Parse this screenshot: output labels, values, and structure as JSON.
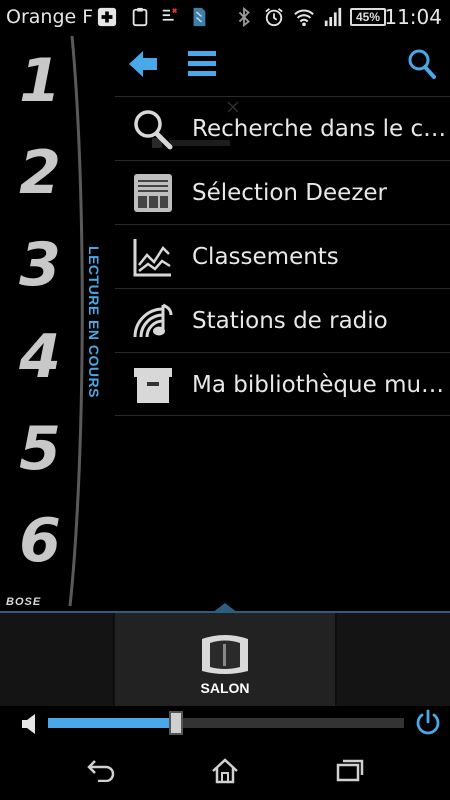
{
  "status_bar": {
    "carrier": "Orange F",
    "battery": "45%",
    "time": "11:04",
    "icons": [
      "health-icon",
      "clipboard-icon",
      "mail-icon",
      "sd-card-icon",
      "bluetooth-icon",
      "alarm-icon",
      "wifi-icon",
      "signal-icon",
      "battery-icon"
    ]
  },
  "presets": {
    "numbers": [
      "1",
      "2",
      "3",
      "4",
      "5",
      "6"
    ],
    "now_playing_label": "LECTURE EN COURS",
    "brand": "BOSE"
  },
  "toolbar": {
    "icons": [
      "back-arrow-icon",
      "menu-list-icon",
      "search-icon"
    ]
  },
  "menu": {
    "items": [
      {
        "label": "Recherche dans le c…",
        "icon": "search-icon"
      },
      {
        "label": "Sélection Deezer",
        "icon": "deezer-icon"
      },
      {
        "label": "Classements",
        "icon": "chart-icon"
      },
      {
        "label": "Stations de radio",
        "icon": "radio-icon"
      },
      {
        "label": "Ma bibliothèque mu…",
        "icon": "archive-box-icon"
      }
    ]
  },
  "speaker_panel": {
    "selected_speaker": "SALON"
  },
  "volume": {
    "level_fraction": 0.35
  },
  "colors": {
    "accent": "#4aa8e8",
    "background": "#000000",
    "text": "#e8e8e8"
  },
  "nav_bar": {
    "icons": [
      "back-icon",
      "home-icon",
      "recent-apps-icon"
    ]
  }
}
